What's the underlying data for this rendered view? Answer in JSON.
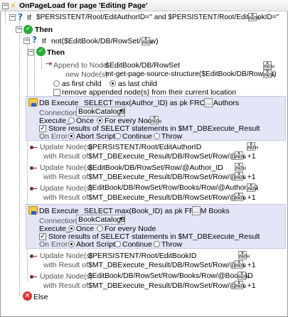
{
  "header": {
    "title": "OnPageLoad for page 'Editing Page'"
  },
  "if1": {
    "kw": "If",
    "cond": "$PERSISTENT/Root/EditAuthorID='' and $PERSISTENT/Root/EditBookID=''"
  },
  "then1": {
    "label": "Then"
  },
  "if2": {
    "kw": "If",
    "cond": "not($EditBook/DB/RowSet/Row)"
  },
  "then2": {
    "label": "Then"
  },
  "append": {
    "label": "Append to Node",
    "target": "$EditBook/DB/RowSet",
    "new_label": "new Node(s)",
    "new_value": "mt-get-page-source-structure($EditBook/DB/RowSet)",
    "first_child": "as first child",
    "last_child": "as last child",
    "remove_label": "remove appended node(s) from their current location"
  },
  "db1": {
    "label": "DB Execute",
    "query": "SELECT max(Author_ID) as pk FROM Authors",
    "conn_label": "Connection",
    "conn_value": "BookCatalog3",
    "exec_label": "Execute_",
    "once": "Once",
    "every": "For every Node",
    "store": "Store results of SELECT statements in $MT_DBExecute_Result",
    "onerror": "On Error",
    "abort": "Abort Script",
    "cont": "Continue",
    "throw": "Throw"
  },
  "upd1": {
    "label": "Update Node(s)",
    "target": "$PERSISTENT/Root/EditAuthorID",
    "with": "with Result of",
    "value": "$MT_DBExecute_Result/DB/RowSet/Row/@pk +1"
  },
  "upd2": {
    "label": "Update Node(s)",
    "target": "$EditBook/DB/RowSet/Row/@Author_ID",
    "with": "with Result of",
    "value": "$MT_DBExecute_Result/DB/RowSet/Row/@pk +1"
  },
  "upd3": {
    "label": "Update Node(s)",
    "target": "$EditBook/DB/RowSet/Row/Books/Row/@Author_ID",
    "with": "with Result of",
    "value": "$MT_DBExecute_Result/DB/RowSet/Row/@pk +1"
  },
  "db2": {
    "label": "DB Execute",
    "query": "SELECT max(Book_ID) as pk FROM Books",
    "conn_label": "Connection",
    "conn_value": "BookCatalog3",
    "exec_label": "Execute_",
    "once": "Once",
    "every": "For every Node",
    "store": "Store results of SELECT statements in $MT_DBExecute_Result",
    "onerror": "On Error",
    "abort": "Abort Script",
    "cont": "Continue",
    "throw": "Throw"
  },
  "upd4": {
    "label": "Update Node(s)",
    "target": "$PERSISTENT/Root/EditBookID",
    "with": "with Result of",
    "value": "$MT_DBExecute_Result/DB/RowSet/Row/@pk +1"
  },
  "upd5": {
    "label": "Update Node(s)",
    "target": "$EditBook/DB/RowSet/Row/Books/Row/@Book_ID",
    "with": "with Result of",
    "value": "$MT_DBExecute_Result/DB/RowSet/Row/@pk +1"
  },
  "else1": {
    "label": "Else"
  },
  "icons": {
    "collapse": "minus-box-icon",
    "event": "lightning-icon",
    "if": "question-icon",
    "then": "checkmark-circle-icon",
    "else": "x-circle-icon",
    "xpath": "xpath-button-icon",
    "db": "database-icon",
    "update": "update-node-icon",
    "append": "append-node-icon",
    "browse": "ellipsis-button",
    "dropdown": "dropdown-arrow-icon"
  },
  "colors": {
    "panel": "#e4e6f7",
    "then": "#2bab3a",
    "else": "#e03232",
    "if": "#1b63c9",
    "event": "#e6a800"
  }
}
